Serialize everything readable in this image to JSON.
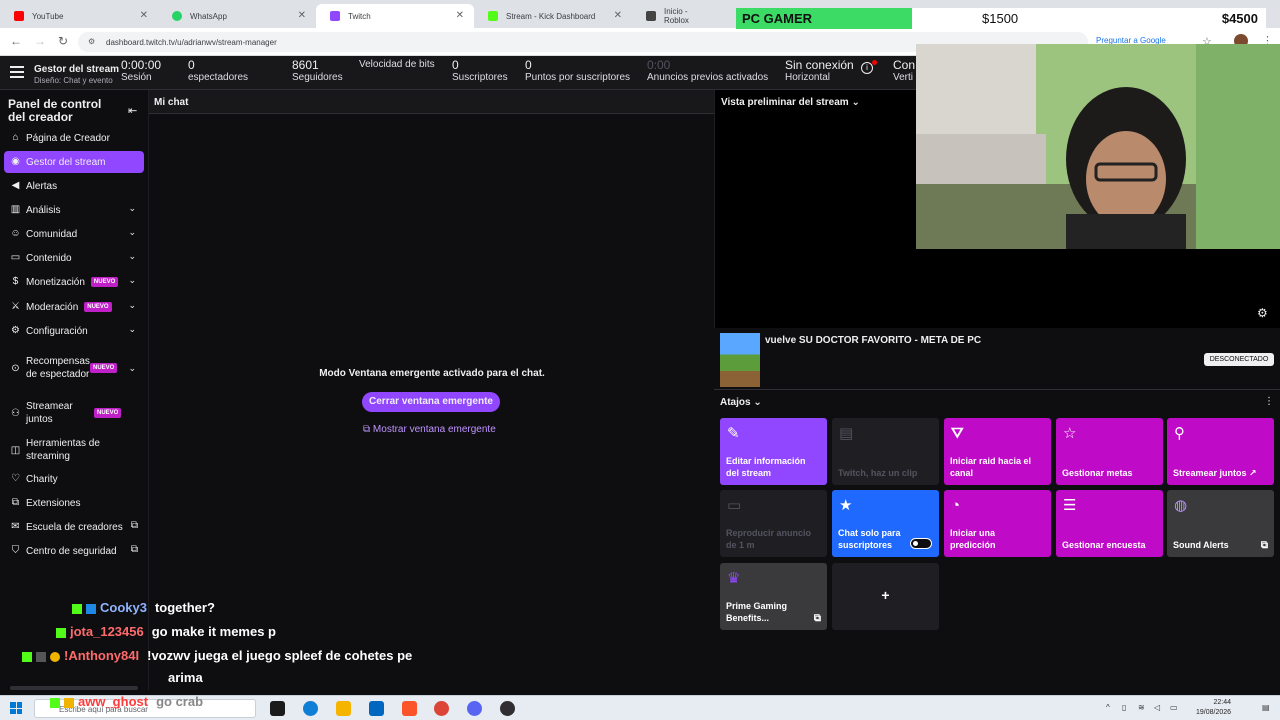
{
  "browser": {
    "tabs": [
      {
        "title": "YouTube",
        "color": "#ff0000"
      },
      {
        "title": "WhatsApp",
        "color": "#25d366"
      },
      {
        "title": "Twitch",
        "color": "#9147ff"
      },
      {
        "title": "Stream - Kick Dashboard",
        "color": "#53fc18"
      },
      {
        "title": "Inicio - Roblox",
        "color": "#444444"
      }
    ],
    "url": "dashboard.twitch.tv/u/adrianwv/stream-manager",
    "translate_label": "Preguntar a Google"
  },
  "stats": {
    "title": "Gestor del stream",
    "subtitle": "Diseño: Chat y evento",
    "items": [
      {
        "value": "0:00:00",
        "label": "Sesión"
      },
      {
        "value": "0",
        "label": "espectadores"
      },
      {
        "value": "8601",
        "label": "Seguidores"
      },
      {
        "value": "",
        "label": "Velocidad de bits"
      },
      {
        "value": "0",
        "label": "Suscriptores"
      },
      {
        "value": "0",
        "label": "Puntos por suscriptores"
      },
      {
        "value": "0:00",
        "label": "Anuncios previos activados"
      },
      {
        "value": "Sin conexión",
        "label": "Horizontal"
      },
      {
        "value": "Con",
        "label": "Verti"
      }
    ]
  },
  "sidebar": {
    "title": "Panel de control del creador",
    "new_badge": "NUEVO",
    "items": [
      {
        "label": "Página de Creador"
      },
      {
        "label": "Gestor del stream"
      },
      {
        "label": "Alertas"
      },
      {
        "label": "Análisis"
      },
      {
        "label": "Comunidad"
      },
      {
        "label": "Contenido"
      },
      {
        "label": "Monetización"
      },
      {
        "label": "Moderación"
      },
      {
        "label": "Configuración"
      },
      {
        "label": "Recompensas de espectador"
      },
      {
        "label": "Streamear juntos"
      },
      {
        "label": "Herramientas de streaming"
      },
      {
        "label": "Charity"
      },
      {
        "label": "Extensiones"
      },
      {
        "label": "Escuela de creadores"
      },
      {
        "label": "Centro de seguridad"
      }
    ]
  },
  "chat": {
    "header": "Mi chat",
    "popout_message": "Modo Ventana emergente activado para el chat.",
    "close_popout": "Cerrar ventana emergente",
    "show_popout": "Mostrar ventana emergente"
  },
  "preview": {
    "header": "Vista preliminar del stream",
    "stream_title": "vuelve SU DOCTOR FAVORITO - META DE PC",
    "status": "DESCONECTADO"
  },
  "shortcuts": {
    "header": "Atajos",
    "items": [
      {
        "label": "Editar información del stream"
      },
      {
        "label": "Twitch, haz un clip"
      },
      {
        "label": "Iniciar raid hacia el canal"
      },
      {
        "label": "Gestionar metas"
      },
      {
        "label": "Streamear juntos"
      },
      {
        "label": "Reproducir anuncio de 1 m"
      },
      {
        "label": "Chat solo para suscriptores"
      },
      {
        "label": "Iniciar una predicción"
      },
      {
        "label": "Gestionar encuesta"
      },
      {
        "label": "Sound Alerts"
      },
      {
        "label": "Prime Gaming Benefits..."
      },
      {
        "label": "+"
      }
    ]
  },
  "goal": {
    "name": "PC GAMER",
    "current": "$1500",
    "target": "$4500",
    "progress": 0.333,
    "fill_color": "#3cdb65"
  },
  "chat_overlay": [
    {
      "user": "Cooky3",
      "message": "together?",
      "color": "#8fb4ff"
    },
    {
      "user": "jota_123456",
      "message": "go make it memes p",
      "color": "#ff6b6b"
    },
    {
      "user": "!Anthony84I",
      "message": "!vozwv juega el juego spleef de cohetes pe",
      "color": "#ff6b6b"
    },
    {
      "user": "",
      "message": "arima",
      "color": "#ffffff"
    },
    {
      "user": "aww_ghost",
      "message": "go crab",
      "color": "#ff3b3b"
    }
  ],
  "taskbar": {
    "search_placeholder": "Escribe aquí para buscar",
    "time": "22:44",
    "date": "19/08/2026"
  }
}
